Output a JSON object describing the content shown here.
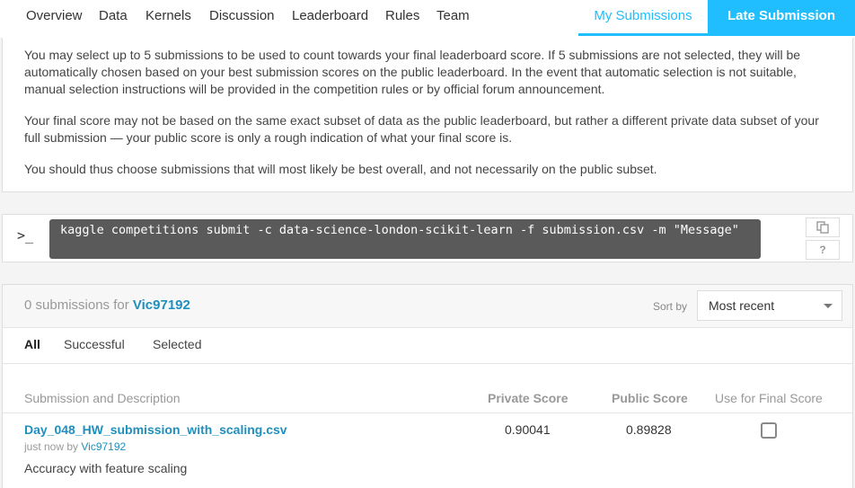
{
  "nav": {
    "tabs": [
      "Overview",
      "Data",
      "Kernels",
      "Discussion",
      "Leaderboard",
      "Rules",
      "Team"
    ],
    "my_submissions": "My Submissions",
    "late_submission": "Late Submission"
  },
  "info": {
    "p1": "You may select up to 5 submissions to be used to count towards your final leaderboard score. If 5 submissions are not selected, they will be automatically chosen based on your best submission scores on the public leaderboard. In the event that automatic selection is not suitable, manual selection instructions will be provided in the competition rules or by official forum announcement.",
    "p2": "Your final score may not be based on the same exact subset of data as the public leaderboard, but rather a different private data subset of your full submission — your public score is only a rough indication of what your final score is.",
    "p3": "You should thus choose submissions that will most likely be best overall, and not necessarily on the public subset."
  },
  "command": {
    "prompt": ">_",
    "text": "kaggle competitions submit -c data-science-london-scikit-learn -f submission.csv -m \"Message\"",
    "copy_icon": "copy-icon",
    "help": "?"
  },
  "submissions": {
    "count_text": "0 submissions for",
    "user": "Vic97192",
    "sort_label": "Sort by",
    "sort_value": "Most recent",
    "filters": [
      "All",
      "Successful",
      "Selected"
    ],
    "columns": {
      "description": "Submission and Description",
      "private": "Private Score",
      "public": "Public Score",
      "final": "Use for Final Score"
    },
    "rows": [
      {
        "file": "Day_048_HW_submission_with_scaling.csv",
        "meta_prefix": "just now by",
        "meta_user": "Vic97192",
        "description": "Accuracy with feature scaling",
        "private_score": "0.90041",
        "public_score": "0.89828",
        "selected": false
      }
    ]
  },
  "colors": {
    "accent": "#20beff",
    "link": "#1f8fbd"
  }
}
